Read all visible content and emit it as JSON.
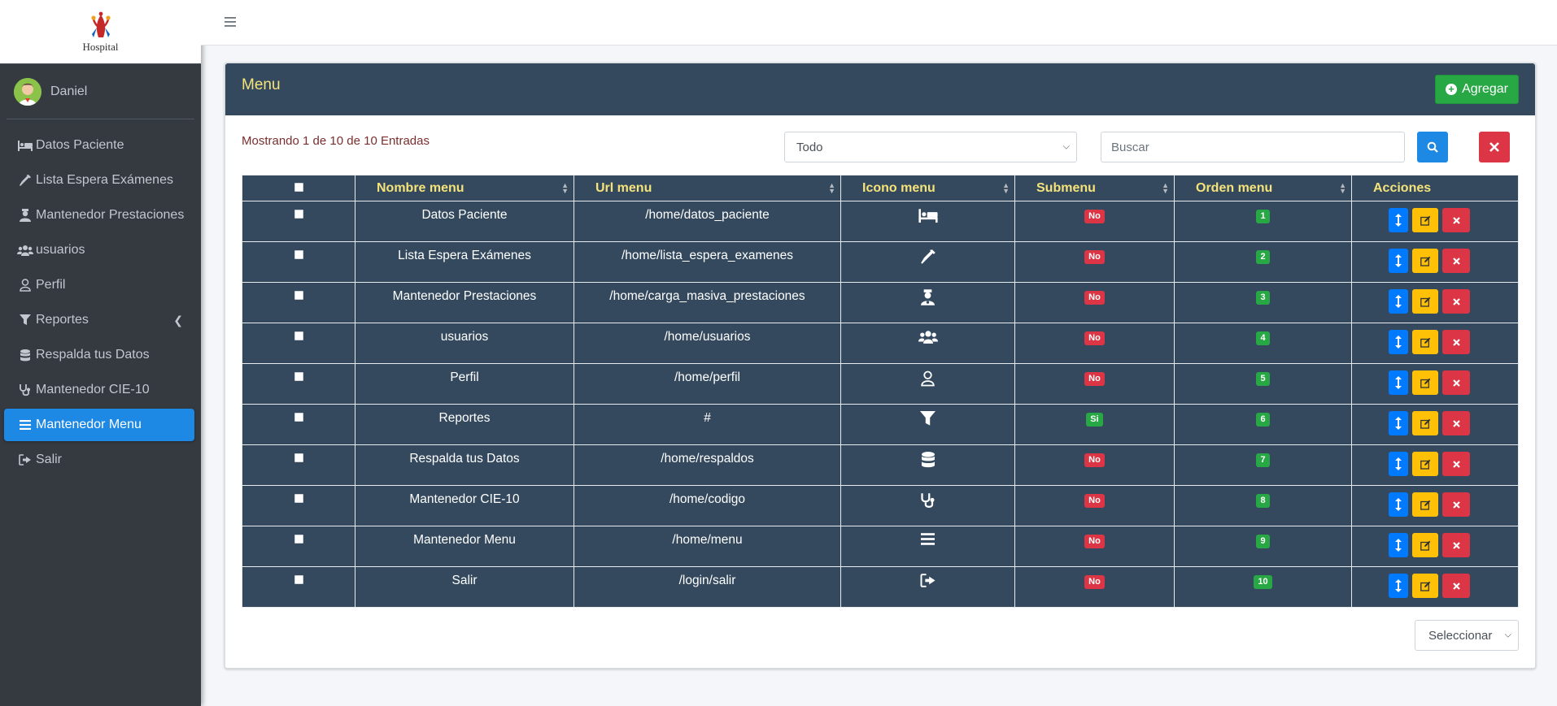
{
  "brand": {
    "name": "Hospital"
  },
  "user": {
    "name": "Daniel"
  },
  "sidebar": {
    "items": [
      {
        "label": "Datos Paciente",
        "icon": "bed-icon"
      },
      {
        "label": "Lista Espera Exámenes",
        "icon": "syringe-icon"
      },
      {
        "label": "Mantenedor Prestaciones",
        "icon": "user-nurse-icon"
      },
      {
        "label": "usuarios",
        "icon": "users-icon"
      },
      {
        "label": "Perfil",
        "icon": "user-icon"
      },
      {
        "label": "Reportes",
        "icon": "filter-icon"
      },
      {
        "label": "Respalda tus Datos",
        "icon": "database-icon"
      },
      {
        "label": "Mantenedor CIE-10",
        "icon": "stethoscope-icon"
      },
      {
        "label": "Mantenedor Menu",
        "icon": "bars-icon",
        "active": true
      },
      {
        "label": "Salir",
        "icon": "sign-out-icon"
      }
    ]
  },
  "card": {
    "title": "Menu",
    "add_label": "Agregar",
    "info": "Mostrando 1 de 10 de 10 Entradas",
    "filter_value": "Todo",
    "search_placeholder": "Buscar",
    "page_select": "Seleccionar"
  },
  "table": {
    "headers": [
      "Nombre menu",
      "Url menu",
      "Icono menu",
      "Submenu",
      "Orden menu",
      "Acciones"
    ],
    "rows": [
      {
        "nombre": "Datos Paciente",
        "url": "/home/datos_paciente",
        "icon": "bed-icon",
        "submenu": "No",
        "orden": "1"
      },
      {
        "nombre": "Lista Espera Exámenes",
        "url": "/home/lista_espera_examenes",
        "icon": "syringe-icon",
        "submenu": "No",
        "orden": "2"
      },
      {
        "nombre": "Mantenedor Prestaciones",
        "url": "/home/carga_masiva_prestaciones",
        "icon": "user-nurse-icon",
        "submenu": "No",
        "orden": "3"
      },
      {
        "nombre": "usuarios",
        "url": "/home/usuarios",
        "icon": "users-icon",
        "submenu": "No",
        "orden": "4"
      },
      {
        "nombre": "Perfil",
        "url": "/home/perfil",
        "icon": "user-icon",
        "submenu": "No",
        "orden": "5"
      },
      {
        "nombre": "Reportes",
        "url": "#",
        "icon": "filter-icon",
        "submenu": "Si",
        "orden": "6"
      },
      {
        "nombre": "Respalda tus Datos",
        "url": "/home/respaldos",
        "icon": "database-icon",
        "submenu": "No",
        "orden": "7"
      },
      {
        "nombre": "Mantenedor CIE-10",
        "url": "/home/codigo",
        "icon": "stethoscope-icon",
        "submenu": "No",
        "orden": "8"
      },
      {
        "nombre": "Mantenedor Menu",
        "url": "/home/menu",
        "icon": "bars-icon",
        "submenu": "No",
        "orden": "9"
      },
      {
        "nombre": "Salir",
        "url": "/login/salir",
        "icon": "sign-out-icon",
        "submenu": "No",
        "orden": "10"
      }
    ]
  },
  "colors": {
    "header_bg": "#34495e",
    "title": "#f5e37a",
    "active_nav": "#1e88e5",
    "add_button": "#28a745"
  }
}
